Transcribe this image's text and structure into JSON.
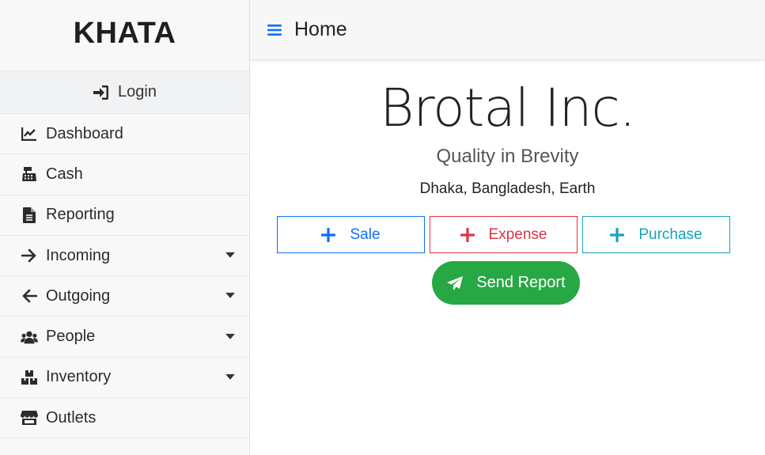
{
  "sidebar": {
    "brand": "KHATA",
    "login_label": "Login",
    "items": [
      {
        "label": "Dashboard",
        "icon": "chart-line-icon"
      },
      {
        "label": "Cash",
        "icon": "cash-register-icon"
      },
      {
        "label": "Reporting",
        "icon": "file-alt-icon"
      },
      {
        "label": "Incoming",
        "icon": "arrow-right-icon",
        "has_dropdown": true
      },
      {
        "label": "Outgoing",
        "icon": "arrow-left-icon",
        "has_dropdown": true
      },
      {
        "label": "People",
        "icon": "users-icon",
        "has_dropdown": true
      },
      {
        "label": "Inventory",
        "icon": "boxes-icon",
        "has_dropdown": true
      },
      {
        "label": "Outlets",
        "icon": "store-icon"
      }
    ]
  },
  "topbar": {
    "title": "Home",
    "menu_icon": "hamburger-icon"
  },
  "main": {
    "company_name": "Brotal Inc.",
    "tagline": "Quality in Brevity",
    "location": "Dhaka, Bangladesh, Earth",
    "actions": {
      "sale": "Sale",
      "expense": "Expense",
      "purchase": "Purchase"
    },
    "send_report": "Send Report"
  },
  "colors": {
    "sale": "#0d6efd",
    "expense": "#dc3545",
    "purchase": "#17a2b8",
    "send_report": "#28a745",
    "hamburger": "#0d6efd"
  }
}
